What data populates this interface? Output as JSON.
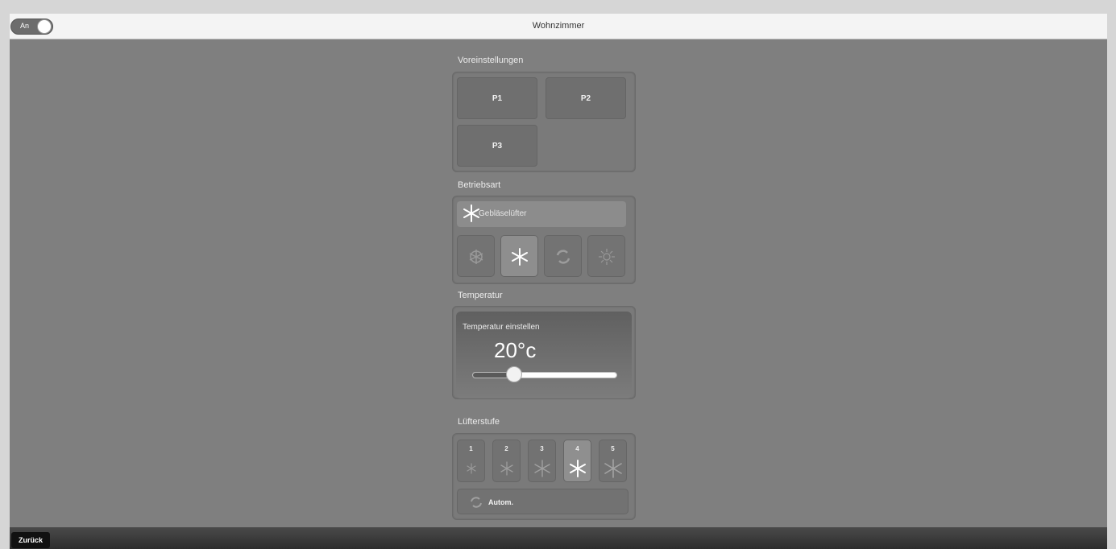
{
  "header": {
    "title": "Wohnzimmer",
    "toggle_label": "An"
  },
  "presets": {
    "title": "Voreinstellungen",
    "items": [
      "P1",
      "P2",
      "P3"
    ]
  },
  "mode": {
    "title": "Betriebsart",
    "current_label": "Gebläselüfter",
    "options": [
      {
        "icon": "snowflake-icon",
        "active": false
      },
      {
        "icon": "fan-icon",
        "active": true
      },
      {
        "icon": "auto-cycle-icon",
        "active": false
      },
      {
        "icon": "sun-icon",
        "active": false
      }
    ]
  },
  "temperature": {
    "title": "Temperatur",
    "label": "Temperatur einstellen",
    "value": "20°c",
    "slider_fraction": 0.29
  },
  "fan_speed": {
    "title": "Lüfterstufe",
    "levels": [
      "1",
      "2",
      "3",
      "4",
      "5"
    ],
    "selected": "4",
    "auto_label": "Autom."
  },
  "footer": {
    "back_label": "Zurück"
  },
  "colors": {
    "panel": "#7a7a7a",
    "background": "#7f7f7f",
    "active_button": "#8f8f8f"
  }
}
